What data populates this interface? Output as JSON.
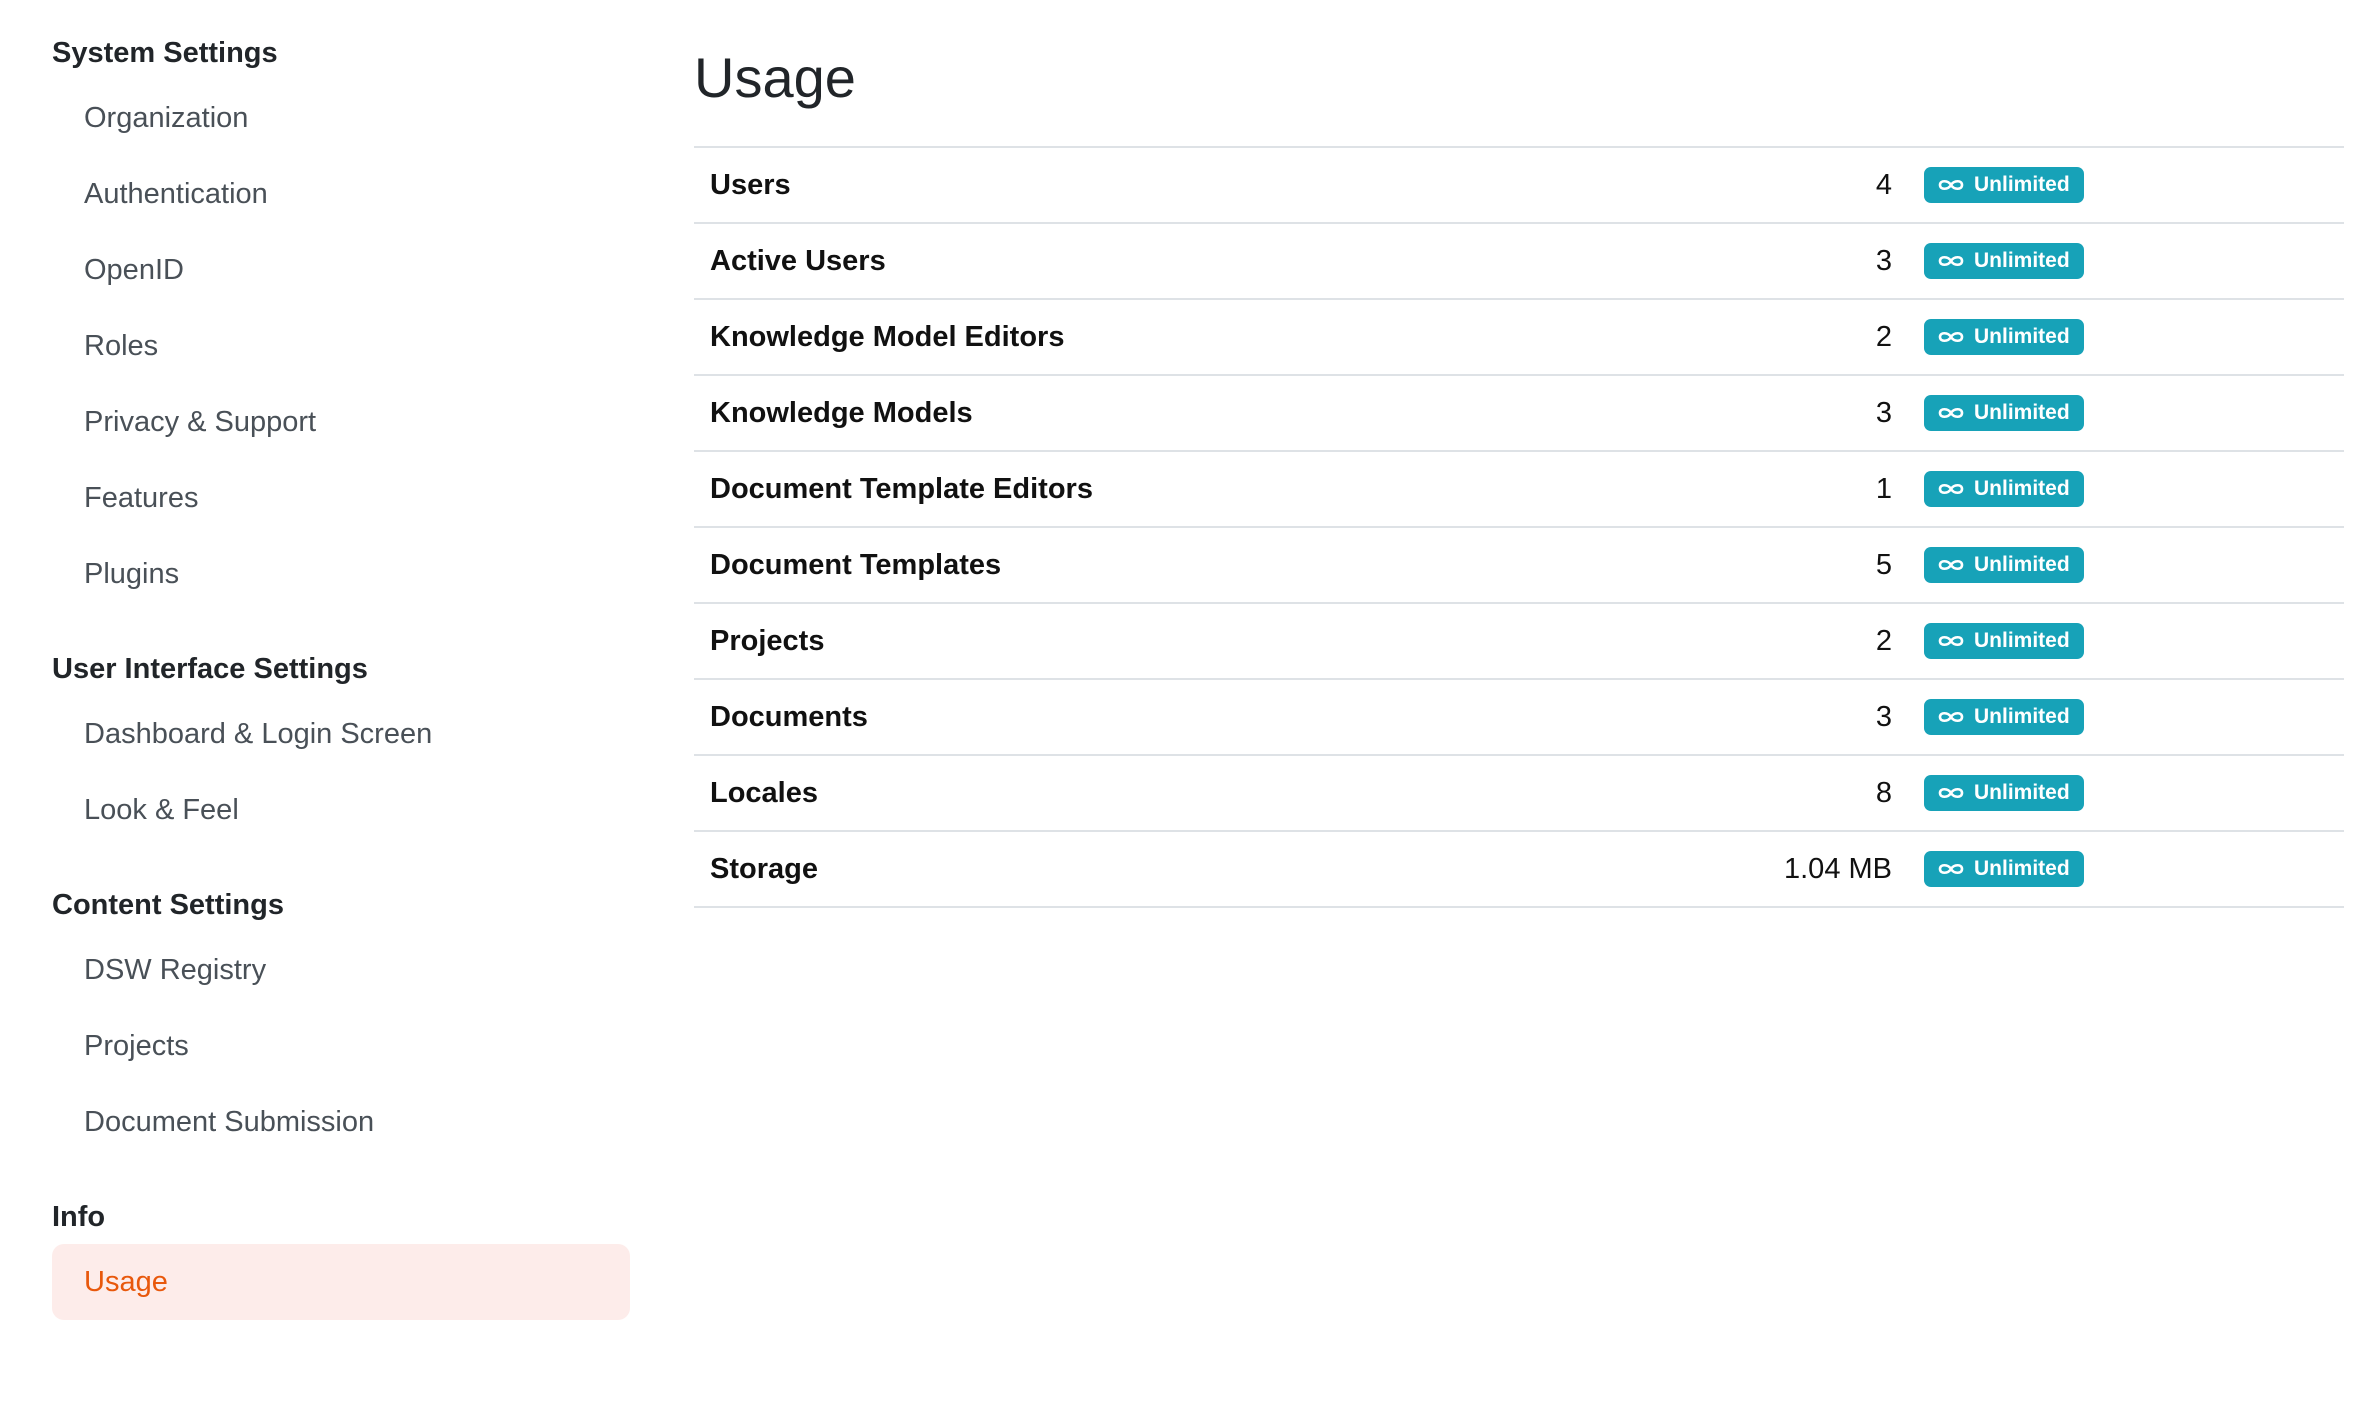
{
  "sidebar": {
    "sections": [
      {
        "title": "System Settings",
        "items": [
          "Organization",
          "Authentication",
          "OpenID",
          "Roles",
          "Privacy & Support",
          "Features",
          "Plugins"
        ]
      },
      {
        "title": "User Interface Settings",
        "items": [
          "Dashboard & Login Screen",
          "Look & Feel"
        ]
      },
      {
        "title": "Content Settings",
        "items": [
          "DSW Registry",
          "Projects",
          "Document Submission"
        ]
      },
      {
        "title": "Info",
        "items": [
          "Usage"
        ]
      }
    ],
    "active_item": "Usage"
  },
  "main": {
    "title": "Usage",
    "rows": [
      {
        "label": "Users",
        "value": "4",
        "limit": "Unlimited"
      },
      {
        "label": "Active Users",
        "value": "3",
        "limit": "Unlimited"
      },
      {
        "label": "Knowledge Model Editors",
        "value": "2",
        "limit": "Unlimited"
      },
      {
        "label": "Knowledge Models",
        "value": "3",
        "limit": "Unlimited"
      },
      {
        "label": "Document Template Editors",
        "value": "1",
        "limit": "Unlimited"
      },
      {
        "label": "Document Templates",
        "value": "5",
        "limit": "Unlimited"
      },
      {
        "label": "Projects",
        "value": "2",
        "limit": "Unlimited"
      },
      {
        "label": "Documents",
        "value": "3",
        "limit": "Unlimited"
      },
      {
        "label": "Locales",
        "value": "8",
        "limit": "Unlimited"
      },
      {
        "label": "Storage",
        "value": "1.04 MB",
        "limit": "Unlimited"
      }
    ]
  },
  "icons": {
    "badge_icon": "infinity-icon"
  },
  "colors": {
    "accent": "#e8580c",
    "active_bg": "#fdecea",
    "badge": "#17a2b8"
  }
}
